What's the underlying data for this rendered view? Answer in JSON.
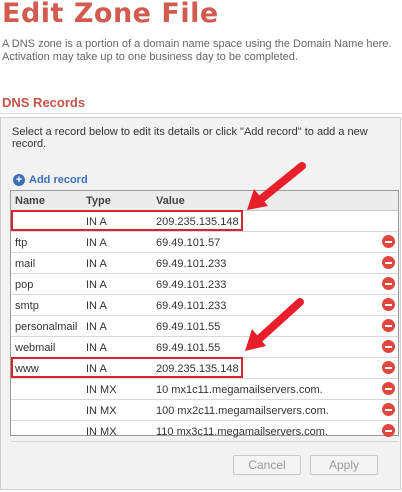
{
  "page": {
    "title": "Edit Zone File",
    "description": "A DNS zone is a portion of a domain name space using the Domain Name here. Activation may take up to one business day to be completed."
  },
  "dns_records": {
    "section_title": "DNS Records",
    "instructions": "Select a record below to edit its details or click \"Add record\" to add a new record.",
    "add_record_label": "Add record",
    "columns": [
      "Name",
      "Type",
      "Value"
    ],
    "rows": [
      {
        "name": "",
        "type": "IN A",
        "value": "209.235.135.148",
        "deletable": false,
        "highlighted": true
      },
      {
        "name": "ftp",
        "type": "IN A",
        "value": "69.49.101.57",
        "deletable": true,
        "highlighted": false
      },
      {
        "name": "mail",
        "type": "IN A",
        "value": "69.49.101.233",
        "deletable": true,
        "highlighted": false
      },
      {
        "name": "pop",
        "type": "IN A",
        "value": "69.49.101.233",
        "deletable": true,
        "highlighted": false
      },
      {
        "name": "smtp",
        "type": "IN A",
        "value": "69.49.101.233",
        "deletable": true,
        "highlighted": false
      },
      {
        "name": "personalmail",
        "type": "IN A",
        "value": "69.49.101.55",
        "deletable": true,
        "highlighted": false
      },
      {
        "name": "webmail",
        "type": "IN A",
        "value": "69.49.101.55",
        "deletable": true,
        "highlighted": false
      },
      {
        "name": "www",
        "type": "IN A",
        "value": "209.235.135.148",
        "deletable": true,
        "highlighted": true
      },
      {
        "name": "",
        "type": "IN MX",
        "value": "10 mx1c11.megamailservers.com.",
        "deletable": true,
        "highlighted": false
      },
      {
        "name": "",
        "type": "IN MX",
        "value": "100 mx2c11.megamailservers.com.",
        "deletable": true,
        "highlighted": false
      },
      {
        "name": "",
        "type": "IN MX",
        "value": "110 mx3c11.megamailservers.com.",
        "deletable": true,
        "highlighted": false
      }
    ],
    "cancel_label": "Cancel",
    "apply_label": "Apply"
  },
  "colors": {
    "title": "#d35a4f",
    "link": "#3d6fb5",
    "highlight": "#d42632",
    "delete_icon": "#e0463d"
  },
  "icons": {
    "add": "plus-circle-icon",
    "delete": "minus-circle-icon",
    "annotation": "red-arrow-icon"
  }
}
